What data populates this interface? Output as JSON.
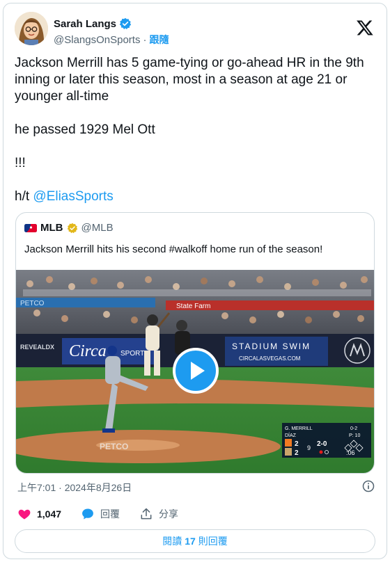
{
  "author": {
    "display_name": "Sarah Langs",
    "handle": "@SlangsOnSports",
    "follow_label": "跟隨"
  },
  "tweet": {
    "line1": "Jackson Merrill has 5 game-tying or go-ahead HR in the 9th inning or later this season, most in a season at age 21 or younger all-time",
    "line2": "he passed 1929 Mel Ott",
    "line3": "!!!",
    "ht_prefix": "h/t ",
    "ht_link": "@EliasSports"
  },
  "quote": {
    "display_name": "MLB",
    "handle": "@MLB",
    "text": "Jackson Merrill hits his second #walkoff home run of the season!",
    "scoreboard": {
      "batter": "G. MERRILL",
      "batter_stat": "0-2",
      "pitcher": "DÍAZ",
      "pitch_count": "P: 10",
      "away_score": "2",
      "home_score": "2",
      "inning": "9",
      "count": "2-0",
      "clock": ":06"
    },
    "signage": {
      "stadium_swim": "STADIUM SWIM",
      "circa_url": "CIRCALASVEGAS.COM",
      "circa": "Circa",
      "sport": "SPORT",
      "statefarm": "State Farm",
      "reveal": "REVEALDX",
      "petco": "PETCO"
    }
  },
  "timestamp": "上午7:01 · 2024年8月26日",
  "actions": {
    "likes": "1,047",
    "reply_label": "回覆",
    "share_label": "分享"
  },
  "read_replies": {
    "prefix": "閱讀",
    "count": "17",
    "suffix": "則回覆"
  },
  "colors": {
    "accent": "#1d9bf0",
    "like": "#f91880",
    "gold_badge": "#e2b719"
  }
}
